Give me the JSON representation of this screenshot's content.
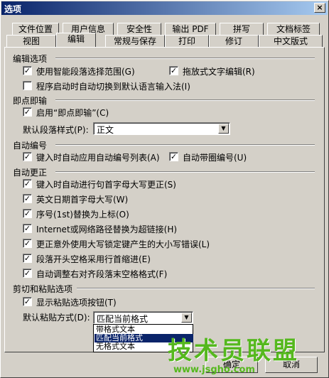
{
  "window": {
    "title": "选项",
    "close_glyph": "×"
  },
  "tabs_row1": [
    "文件位置",
    "用户信息",
    "安全性",
    "输出 PDF",
    "拼写",
    "文档标签"
  ],
  "tabs_row2": [
    "视图",
    "编辑",
    "常规与保存",
    "打印",
    "修订",
    "中文版式"
  ],
  "active_tab": "编辑",
  "sections": {
    "edit": "编辑选项",
    "instant": "即点即输",
    "autonum": "自动编号",
    "autocorrect": "自动更正",
    "paste": "剪切和粘贴选项"
  },
  "options": {
    "smart_para": {
      "label": "使用智能段落选择范围(G)",
      "checked": true
    },
    "drag_text": {
      "label": "拖放式文字编辑(R)",
      "checked": true
    },
    "auto_ime": {
      "label": "程序启动时自动切换到默认语言输入法(I)",
      "checked": false
    },
    "enable_instant": {
      "label": "启用“即点即输”(C)",
      "checked": true
    },
    "auto_numbering": {
      "label": "键入时自动应用自动编号列表(A)",
      "checked": true
    },
    "auto_circle": {
      "label": "自动带圈编号(U)",
      "checked": true
    },
    "ac_capitalize": {
      "label": "键入时自动进行句首字母大写更正(S)",
      "checked": true
    },
    "ac_english_date": {
      "label": "英文日期首字母大写(W)",
      "checked": true
    },
    "ac_ordinal": {
      "label": "序号(1st)替换为上标(O)",
      "checked": true
    },
    "ac_hyperlink": {
      "label": "Internet或网络路径替换为超链接(H)",
      "checked": true
    },
    "ac_capslock": {
      "label": "更正意外使用大写锁定键产生的大小写错误(L)",
      "checked": true
    },
    "ac_indent": {
      "label": "段落开头空格采用行首缩进(E)",
      "checked": true
    },
    "ac_rightalign": {
      "label": "自动调整右对齐段落末空格格式(F)",
      "checked": true
    },
    "show_paste_btn": {
      "label": "显示粘贴选项按钮(T)",
      "checked": true
    }
  },
  "para_style": {
    "label": "默认段落样式(P):",
    "value": "正文"
  },
  "paste_mode": {
    "label": "默认粘贴方式(D):",
    "value": "匹配当前格式",
    "options": [
      "带格式文本",
      "匹配当前格式",
      "无格式文本"
    ],
    "selected_index": 1
  },
  "buttons": {
    "ok": "确定",
    "cancel": "取消"
  },
  "watermark": {
    "text": "技术员联盟",
    "url": "www.jsgho.com"
  },
  "colors": {
    "titlebar": "#0a246a",
    "dialog": "#d4d0c8",
    "watermark": "#55b81e"
  }
}
